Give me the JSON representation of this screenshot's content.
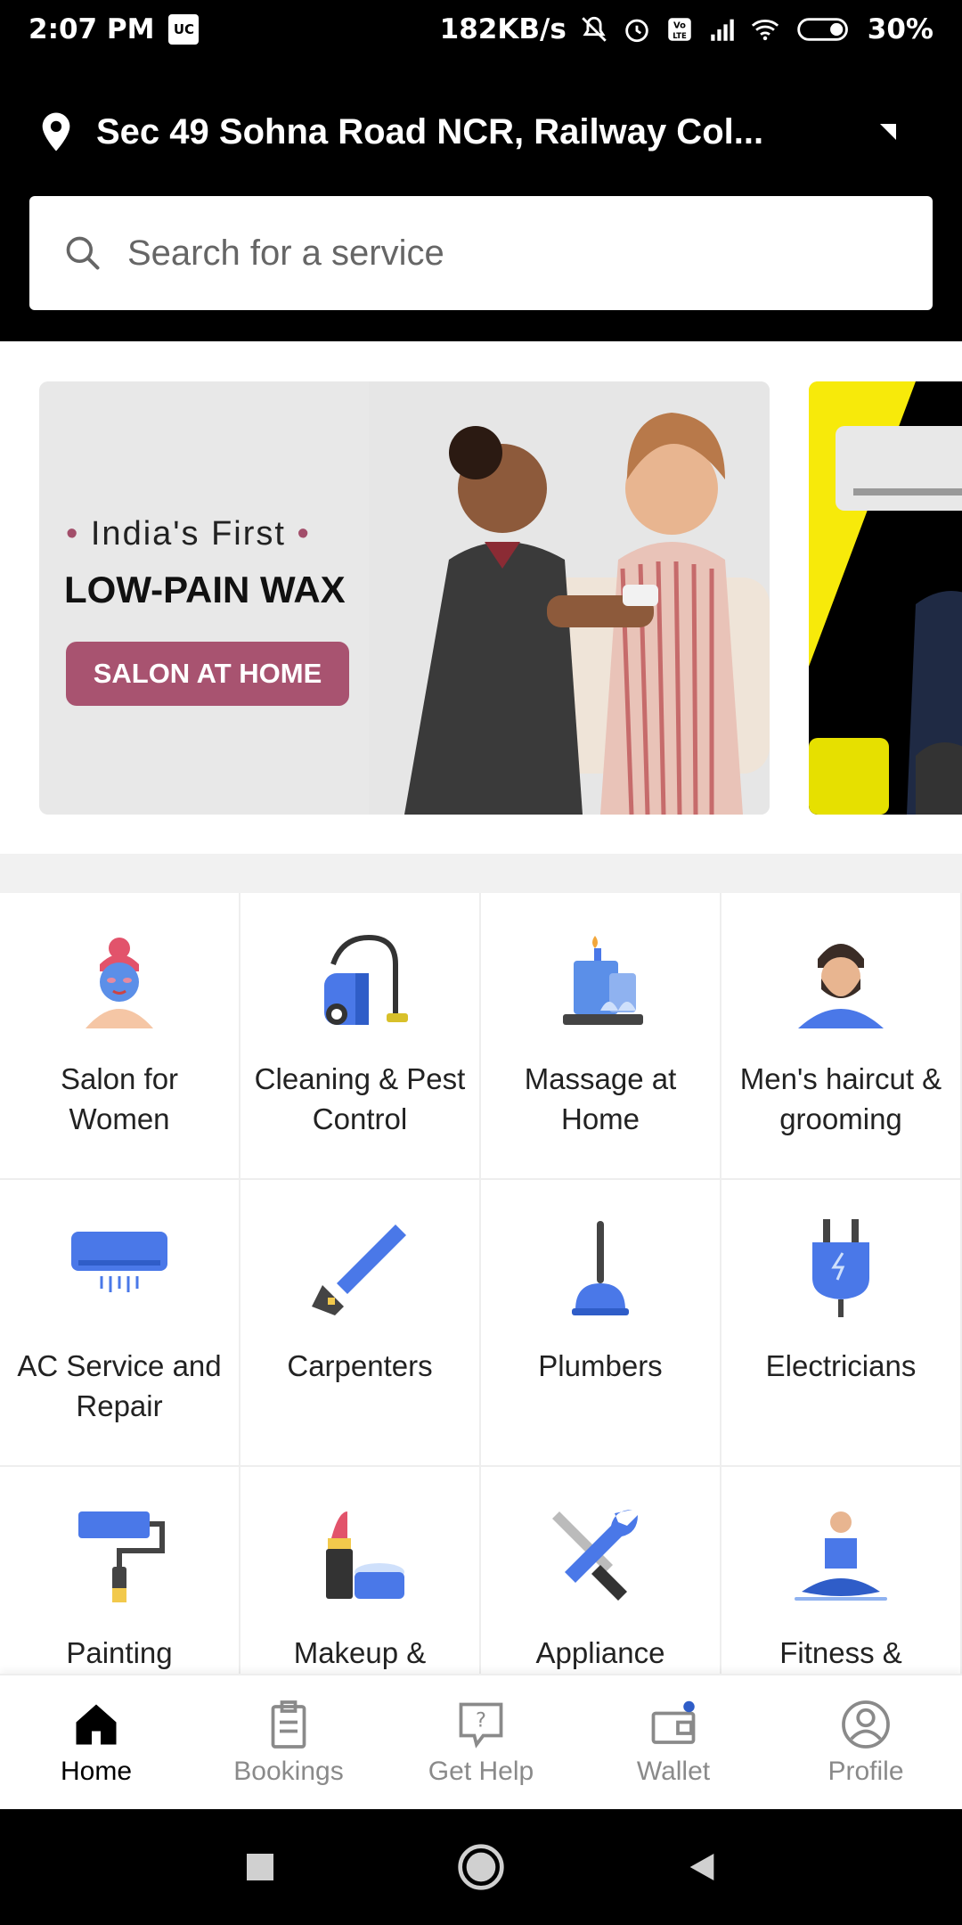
{
  "status": {
    "time": "2:07 PM",
    "app_badge": "UC",
    "network_speed": "182KB/s",
    "battery": "30%"
  },
  "header": {
    "location": "Sec 49 Sohna Road NCR, Railway Col...",
    "search_placeholder": "Search for a service"
  },
  "banner": {
    "tagline": "India's First",
    "title": "LOW-PAIN WAX",
    "cta": "SALON AT HOME"
  },
  "categories": [
    {
      "label": "Salon for Women",
      "icon": "salon-women-icon"
    },
    {
      "label": "Cleaning & Pest Control",
      "icon": "vacuum-cleaner-icon"
    },
    {
      "label": "Massage at Home",
      "icon": "candle-massage-icon"
    },
    {
      "label": "Men's haircut & grooming",
      "icon": "bearded-man-icon"
    },
    {
      "label": "AC Service and Repair",
      "icon": "air-conditioner-icon"
    },
    {
      "label": "Carpenters",
      "icon": "saw-icon"
    },
    {
      "label": "Plumbers",
      "icon": "plunger-icon"
    },
    {
      "label": "Electricians",
      "icon": "plug-icon"
    },
    {
      "label": "Painting",
      "icon": "paint-roller-icon"
    },
    {
      "label": "Makeup &",
      "icon": "lipstick-icon"
    },
    {
      "label": "Appliance",
      "icon": "tools-icon"
    },
    {
      "label": "Fitness &",
      "icon": "yoga-icon"
    }
  ],
  "nav": {
    "home": "Home",
    "bookings": "Bookings",
    "get_help": "Get Help",
    "wallet": "Wallet",
    "profile": "Profile"
  },
  "colors": {
    "accent_blue": "#4a78e8",
    "banner_pink": "#a85370",
    "banner_yellow": "#f7ea0a"
  }
}
